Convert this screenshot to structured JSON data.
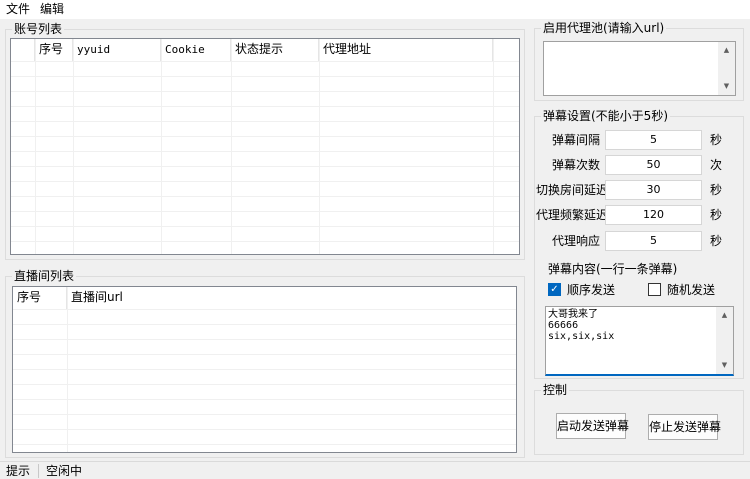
{
  "menu": {
    "file": "文件",
    "edit": "编辑"
  },
  "accounts": {
    "title": "账号列表",
    "columns": [
      "序号",
      "yyuid",
      "Cookie",
      "状态提示",
      "代理地址"
    ]
  },
  "rooms": {
    "title": "直播间列表",
    "columns": [
      "序号",
      "直播间url"
    ]
  },
  "proxy_pool": {
    "title": "启用代理池(请输入url)",
    "value": ""
  },
  "danmaku": {
    "title": "弹幕设置(不能小于5秒)",
    "fields": [
      {
        "label": "弹幕间隔",
        "value": "5",
        "unit": "秒"
      },
      {
        "label": "弹幕次数",
        "value": "50",
        "unit": "次"
      },
      {
        "label": "切换房间延迟",
        "value": "30",
        "unit": "秒"
      },
      {
        "label": "代理频繁延迟",
        "value": "120",
        "unit": "秒"
      },
      {
        "label": "代理响应",
        "value": "5",
        "unit": "秒"
      }
    ],
    "content_label": "弹幕内容(一行一条弹幕)",
    "sequential_label": "顺序发送",
    "sequential_checked": true,
    "random_label": "随机发送",
    "random_checked": false,
    "content": "大哥我来了\n66666\nsix,six,six"
  },
  "control": {
    "title": "控制",
    "start_label": "启动发送弹幕",
    "stop_label": "停止发送弹幕"
  },
  "status": {
    "label": "提示",
    "value": "空闲中"
  },
  "colors": {
    "accent": "#0067c0",
    "list_border": "#828790",
    "background": "#f0f0f0"
  }
}
